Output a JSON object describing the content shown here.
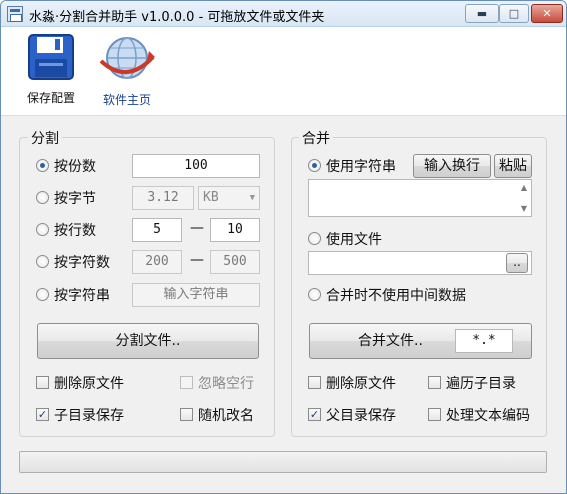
{
  "window": {
    "title": "水淼·分割合并助手 v1.0.0.0 - 可拖放文件或文件夹",
    "controls": {
      "minimize": "▬",
      "maximize": "□",
      "close": "✕"
    }
  },
  "toolbar": {
    "save_config": "保存配置",
    "homepage": "软件主页"
  },
  "split": {
    "title": "分割",
    "options": [
      {
        "label": "按份数",
        "selected": true
      },
      {
        "label": "按字节",
        "selected": false
      },
      {
        "label": "按行数",
        "selected": false
      },
      {
        "label": "按字符数",
        "selected": false
      },
      {
        "label": "按字符串",
        "selected": false
      }
    ],
    "parts_value": "100",
    "bytes_value": "3.12",
    "bytes_unit": "KB",
    "lines_from": "5",
    "lines_to": "10",
    "chars_from": "200",
    "chars_to": "500",
    "range_dash": "—",
    "string_placeholder": "输入字符串",
    "split_button": "分割文件..",
    "delete_original": "删除原文件",
    "ignore_blank": "忽略空行",
    "subdir_save": "子目录保存",
    "random_rename": "随机改名",
    "subdir_checked": "✓"
  },
  "merge": {
    "title": "合并",
    "use_string": "使用字符串",
    "input_newline": "输入换行",
    "paste": "粘贴",
    "use_file": "使用文件",
    "browse": "..",
    "no_temp": "合并时不使用中间数据",
    "merge_button": "合并文件..",
    "pattern": "*.*",
    "delete_original": "删除原文件",
    "traverse_subdirs": "遍历子目录",
    "parent_save": "父目录保存",
    "process_encoding": "处理文本编码",
    "parent_checked": "✓"
  },
  "progress": {
    "fraction": 0
  }
}
